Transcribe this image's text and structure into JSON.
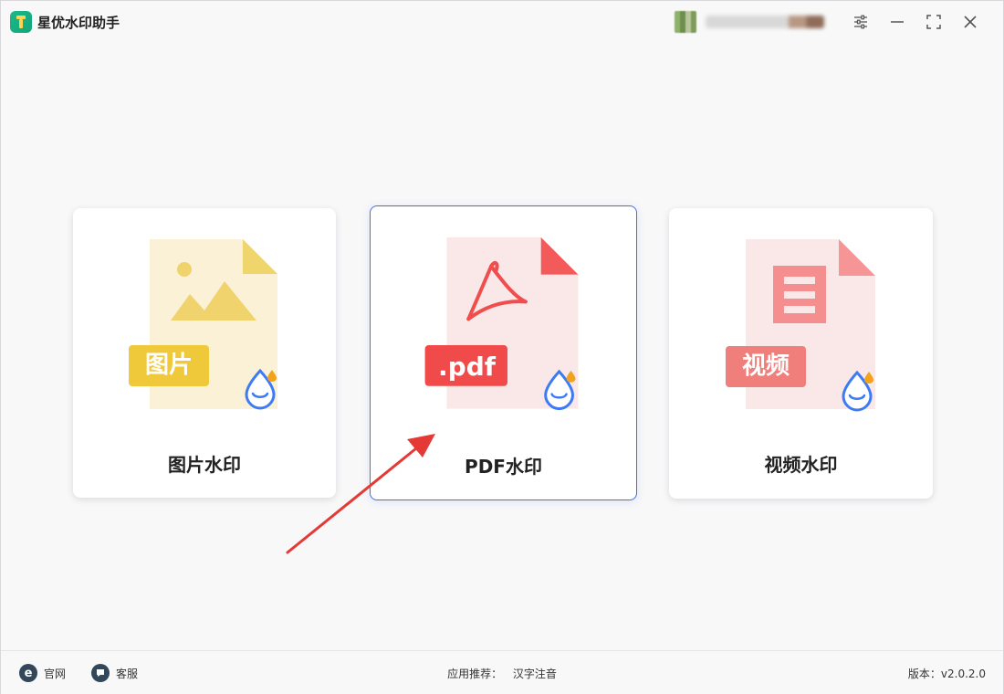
{
  "window": {
    "title": "星优水印助手"
  },
  "cards": {
    "image": {
      "tag": "图片",
      "title": "图片水印"
    },
    "pdf": {
      "tag": ".pdf",
      "title": "PDF水印"
    },
    "video": {
      "tag": "视频",
      "title": "视频水印"
    }
  },
  "footer": {
    "website": "官网",
    "support": "客服",
    "recommend_label": "应用推荐：",
    "recommend_link": "汉字注音",
    "version": "版本：v2.0.2.0"
  },
  "icons": {
    "logo": "app-logo",
    "settings": "sliders-icon",
    "minimize": "minimize-icon",
    "maximize": "maximize-icon",
    "close": "close-icon",
    "website": "browser-e-icon",
    "support": "chat-bubble-icon"
  },
  "colors": {
    "accent": "#3b6ff5",
    "image": "#f0cf42",
    "pdf": "#f04d4d",
    "video": "#f37f7b",
    "arrow": "#e53935"
  }
}
